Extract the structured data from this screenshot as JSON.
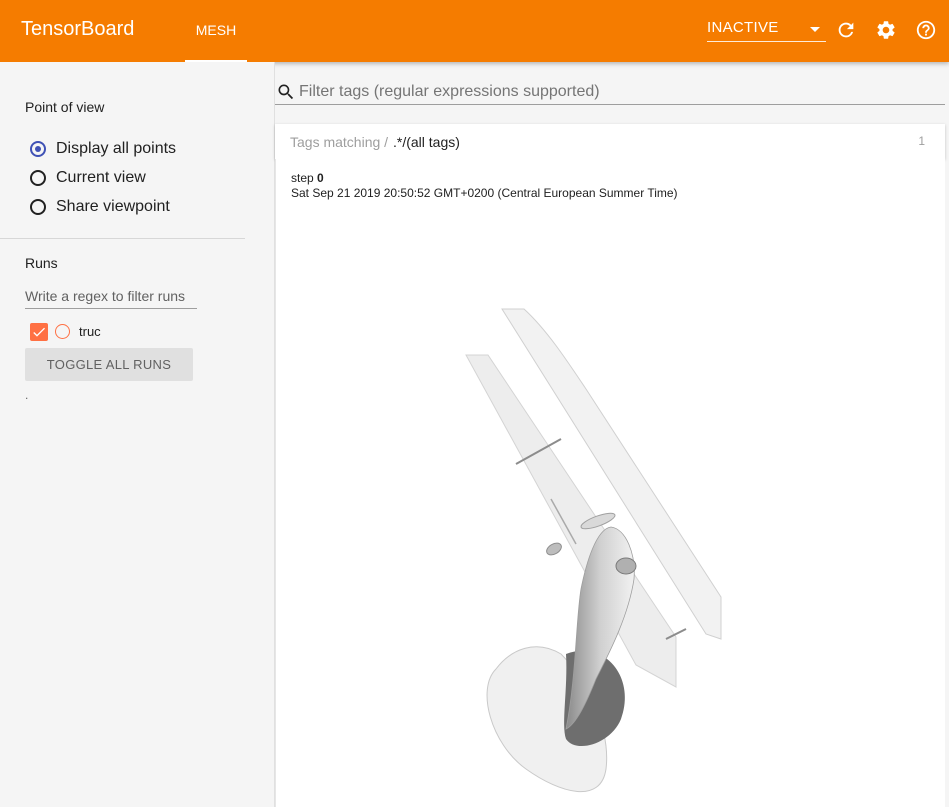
{
  "toolbar": {
    "brand": "TensorBoard",
    "active_tab": "MESH",
    "reload_state": "INACTIVE",
    "color": "#f57c00",
    "icons": [
      "refresh-icon",
      "settings-icon",
      "help-icon"
    ]
  },
  "sidebar": {
    "point_of_view": {
      "title": "Point of view",
      "options": [
        {
          "label": "Display all points",
          "checked": true
        },
        {
          "label": "Current view",
          "checked": false
        },
        {
          "label": "Share viewpoint",
          "checked": false
        }
      ]
    },
    "runs": {
      "title": "Runs",
      "filter_placeholder": "Write a regex to filter runs",
      "items": [
        {
          "name": "truc",
          "checked": true,
          "color": "#ff7043"
        }
      ],
      "toggle_all_label": "TOGGLE ALL RUNS",
      "footer": "."
    }
  },
  "main": {
    "filter_placeholder": "Filter tags (regular expressions supported)",
    "tag_card": {
      "prefix": "Tags matching /",
      "regex": ".*/(all tags)",
      "count": "1",
      "step_label": "step",
      "step_value": "0",
      "wall_time": "Sat Sep 21 2019 20:50:52 GMT+0200 (Central European Summer Time)"
    }
  }
}
